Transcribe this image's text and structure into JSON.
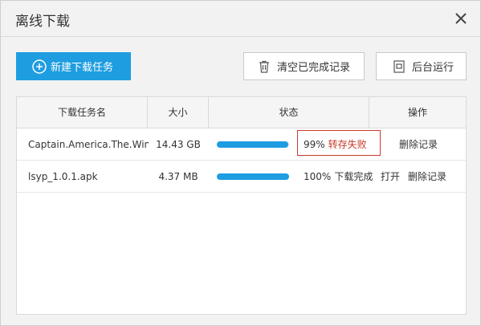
{
  "window": {
    "title": "离线下载"
  },
  "toolbar": {
    "new_task_label": "新建下载任务",
    "clear_completed_label": "清空已完成记录",
    "background_run_label": "后台运行"
  },
  "table": {
    "headers": {
      "name": "下载任务名",
      "size": "大小",
      "status": "状态",
      "ops": "操作"
    },
    "rows": [
      {
        "name": "Captain.America.The.Wint",
        "size": "14.43 GB",
        "progress": 0.99,
        "percent": "99%",
        "status": "转存失败",
        "ops": {
          "delete": "删除记录"
        }
      },
      {
        "name": "lsyp_1.0.1.apk",
        "size": "4.37 MB",
        "progress": 1.0,
        "percent": "100%",
        "status": "下载完成",
        "ops": {
          "open": "打开",
          "delete": "删除记录"
        }
      }
    ]
  },
  "colors": {
    "accent": "#1e9de1",
    "error": "#c8392c",
    "track": "#e4e4e4"
  },
  "icons": {
    "close": "close-icon",
    "add": "plus-circle-icon",
    "clear": "trash-icon",
    "background": "window-icon"
  }
}
